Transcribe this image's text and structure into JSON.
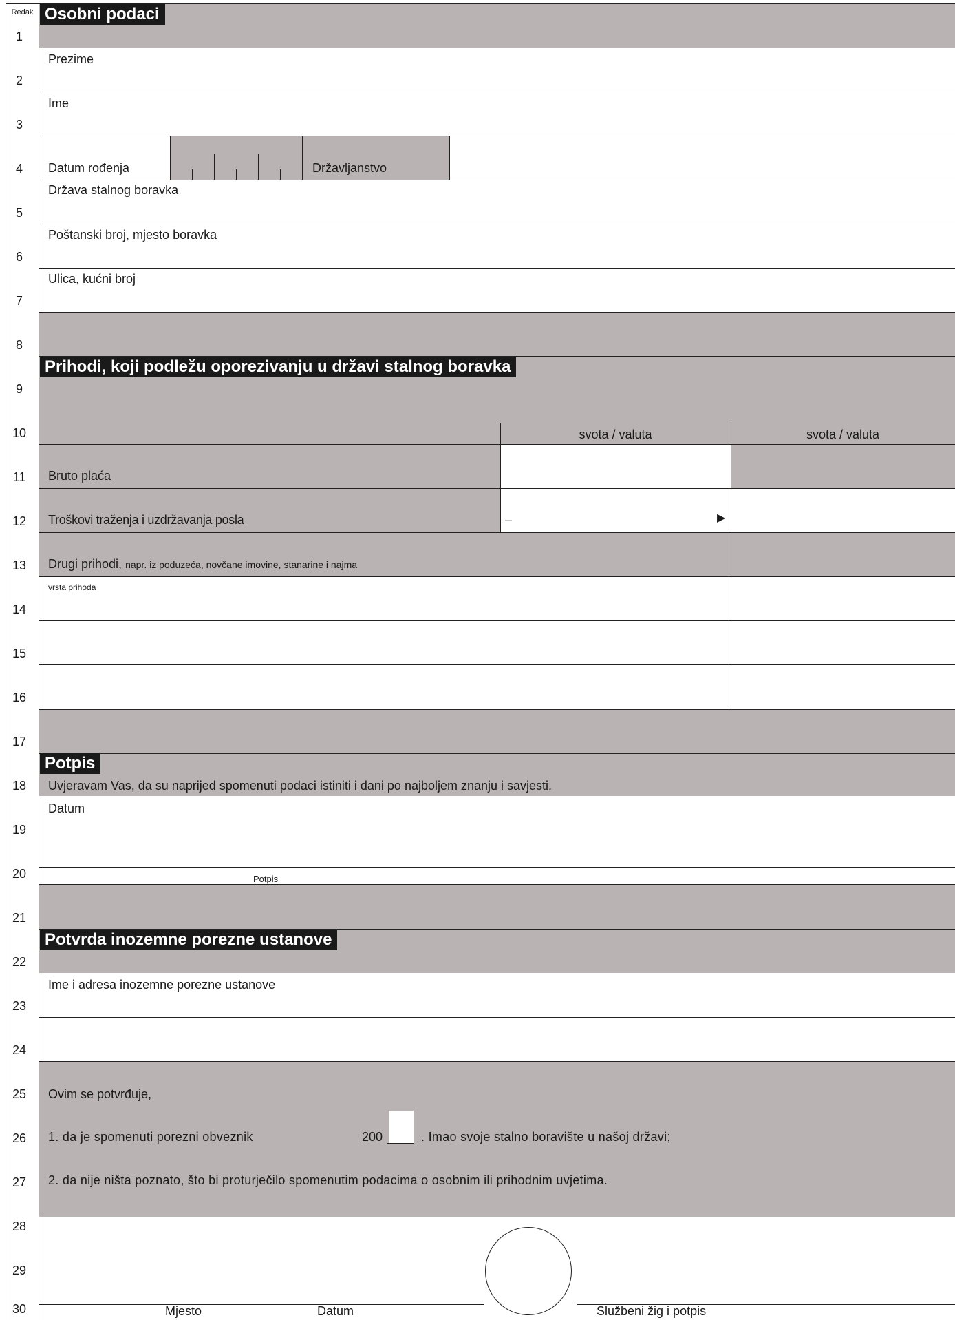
{
  "gutter": {
    "header": "Redak",
    "rows": [
      "1",
      "2",
      "3",
      "4",
      "5",
      "6",
      "7",
      "8",
      "9",
      "10",
      "11",
      "12",
      "13",
      "14",
      "15",
      "16",
      "17",
      "18",
      "19",
      "20",
      "21",
      "22",
      "23",
      "24",
      "25",
      "26",
      "27",
      "28",
      "29",
      "30"
    ]
  },
  "sections": {
    "personal": "Osobni podaci",
    "income": "Prihodi, koji podležu oporezivanju u državi stalnog boravka",
    "signature": "Potpis",
    "confirmation": "Potvrda inozemne porezne ustanove"
  },
  "personal": {
    "surname_label": "Prezime",
    "name_label": "Ime",
    "birthdate_label": "Datum rođenja",
    "citizenship_label": "Državljanstvo",
    "country_label": "Država stalnog boravka",
    "postal_label": "Poštanski broj, mjesto boravka",
    "street_label": "Ulica, kućni broj"
  },
  "income": {
    "col1_header": "svota / valuta",
    "col2_header": "svota / valuta",
    "gross_label": "Bruto plaća",
    "expenses_label": "Troškovi traženja i uzdržavanja posla",
    "expenses_prefix": "–",
    "arrow": "▶",
    "other_label": "Drugi prihodi,",
    "other_note": "napr. iz poduzeća, novčane imovine, stanarine i najma",
    "type_label": "vrsta prihoda"
  },
  "signature": {
    "declaration": "Uvjeravam Vas, da su naprijed spomenuti podaci istiniti i dani po najboljem znanju i savjesti.",
    "date_label": "Datum",
    "sign_label": "Potpis"
  },
  "confirmation": {
    "authority_label": "Ime i adresa inozemne porezne ustanove",
    "intro": "Ovim se potvrđuje,",
    "line1_a": "1.  da je spomenuti porezni obveznik",
    "year_prefix": "200",
    "line1_b": ". Imao svoje stalno boravište u našoj državi;",
    "line2": "2.  da nije ništa poznato, što bi proturječilo spomenutim podacima o osobnim ili prihodnim uvjetima.",
    "place_label": "Mjesto",
    "date_label": "Datum",
    "stamp_label": "Službeni žig i potpis"
  }
}
